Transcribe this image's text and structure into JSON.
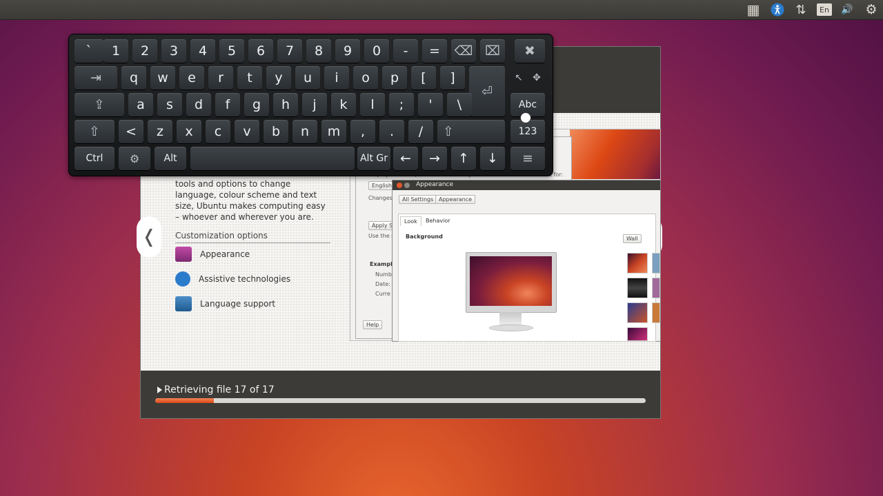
{
  "top_panel": {
    "indicators": [
      {
        "name": "workspace-switcher-icon",
        "glyph": "▦"
      },
      {
        "name": "accessibility-icon",
        "glyph": ""
      },
      {
        "name": "network-icon",
        "glyph": "⇅"
      },
      {
        "name": "keyboard-layout-indicator",
        "glyph": "En"
      },
      {
        "name": "volume-icon",
        "glyph": "🔊"
      },
      {
        "name": "session-gear-icon",
        "glyph": "⚙"
      }
    ]
  },
  "installer": {
    "slide": {
      "intro_text": "tools and options to change language, colour scheme and text size, Ubuntu makes computing easy – whoever and wherever you are.",
      "options_heading": "Customization options",
      "options": [
        {
          "label": "Appearance",
          "icon": "appearance-icon",
          "color": "#a03a8c"
        },
        {
          "label": "Assistive technologies",
          "icon": "accessibility-icon",
          "color": "#2b7bcc"
        },
        {
          "label": "Language support",
          "icon": "language-support-icon",
          "color": "#2e6fa8"
        }
      ],
      "prev_arrow": "❬",
      "next_arrow": "❭"
    },
    "language_window": {
      "text_line": "Display numbers, dates and currency amounts in the usual format for:",
      "dropdown": "English",
      "changes_text": "Changes t",
      "apply_button": "Apply S",
      "use_text": "Use the sa",
      "example_heading": "Exampl",
      "example_rows": [
        "Numb",
        "Date:",
        "Curre"
      ],
      "help_button": "Help"
    },
    "appearance_window": {
      "title": "Appearance",
      "breadcrumbs": [
        "All Settings",
        "Appearance"
      ],
      "tabs": [
        "Look",
        "Behavior"
      ],
      "active_tab": "Look",
      "background_label": "Background",
      "wallpaper_dropdown": "Wall"
    },
    "footer": {
      "status": "Retrieving file 17 of 17",
      "progress": 0.12
    }
  },
  "keyboard": {
    "rows": [
      [
        "`",
        "1",
        "2",
        "3",
        "4",
        "5",
        "6",
        "7",
        "8",
        "9",
        "0",
        "-",
        "=",
        "⌫",
        "⌧",
        "✖"
      ],
      [
        "⇥",
        "q",
        "w",
        "e",
        "r",
        "t",
        "y",
        "u",
        "i",
        "o",
        "p",
        "[",
        "]",
        "⏎",
        "↖",
        "✥"
      ],
      [
        "⇪",
        "a",
        "s",
        "d",
        "f",
        "g",
        "h",
        "j",
        "k",
        "l",
        ";",
        "'",
        "\\",
        "Abc"
      ],
      [
        "⇧",
        "<",
        "z",
        "x",
        "c",
        "v",
        "b",
        "n",
        "m",
        ",",
        ".",
        "/",
        "⇧",
        "123"
      ],
      [
        "Ctrl",
        "⚙",
        "Alt",
        "",
        "Alt Gr",
        "←",
        "→",
        "↑",
        "↓",
        "≡"
      ]
    ]
  }
}
